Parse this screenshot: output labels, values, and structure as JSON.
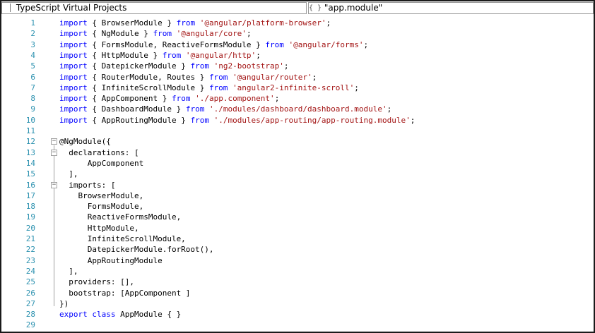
{
  "toolbar": {
    "project_dropdown": "TypeScript Virtual Projects",
    "member_dropdown": "\"app.module\"",
    "member_icon": "{ }"
  },
  "icons": {
    "project": "project-icon",
    "member": "braces-icon",
    "fold": "collapse-minus-icon"
  },
  "colors": {
    "keyword": "#0000ff",
    "string": "#a31515",
    "line_number": "#2b91af",
    "text": "#000000"
  },
  "lines": [
    {
      "n": "1",
      "t": [
        {
          "k": "kw",
          "v": "import"
        },
        {
          "k": "p",
          "v": " { BrowserModule } "
        },
        {
          "k": "kw",
          "v": "from"
        },
        {
          "k": "p",
          "v": " "
        },
        {
          "k": "str",
          "v": "'@angular/platform-browser'"
        },
        {
          "k": "p",
          "v": ";"
        }
      ]
    },
    {
      "n": "2",
      "t": [
        {
          "k": "kw",
          "v": "import"
        },
        {
          "k": "p",
          "v": " { NgModule } "
        },
        {
          "k": "kw",
          "v": "from"
        },
        {
          "k": "p",
          "v": " "
        },
        {
          "k": "str",
          "v": "'@angular/core'"
        },
        {
          "k": "p",
          "v": ";"
        }
      ]
    },
    {
      "n": "3",
      "t": [
        {
          "k": "kw",
          "v": "import"
        },
        {
          "k": "p",
          "v": " { FormsModule, ReactiveFormsModule } "
        },
        {
          "k": "kw",
          "v": "from"
        },
        {
          "k": "p",
          "v": " "
        },
        {
          "k": "str",
          "v": "'@angular/forms'"
        },
        {
          "k": "p",
          "v": ";"
        }
      ]
    },
    {
      "n": "4",
      "t": [
        {
          "k": "kw",
          "v": "import"
        },
        {
          "k": "p",
          "v": " { HttpModule } "
        },
        {
          "k": "kw",
          "v": "from"
        },
        {
          "k": "p",
          "v": " "
        },
        {
          "k": "str",
          "v": "'@angular/http'"
        },
        {
          "k": "p",
          "v": ";"
        }
      ]
    },
    {
      "n": "5",
      "t": [
        {
          "k": "kw",
          "v": "import"
        },
        {
          "k": "p",
          "v": " { DatepickerModule } "
        },
        {
          "k": "kw",
          "v": "from"
        },
        {
          "k": "p",
          "v": " "
        },
        {
          "k": "str",
          "v": "'ng2-bootstrap'"
        },
        {
          "k": "p",
          "v": ";"
        }
      ]
    },
    {
      "n": "6",
      "t": [
        {
          "k": "kw",
          "v": "import"
        },
        {
          "k": "p",
          "v": " { RouterModule, Routes } "
        },
        {
          "k": "kw",
          "v": "from"
        },
        {
          "k": "p",
          "v": " "
        },
        {
          "k": "str",
          "v": "'@angular/router'"
        },
        {
          "k": "p",
          "v": ";"
        }
      ]
    },
    {
      "n": "7",
      "t": [
        {
          "k": "kw",
          "v": "import"
        },
        {
          "k": "p",
          "v": " { InfiniteScrollModule } "
        },
        {
          "k": "kw",
          "v": "from"
        },
        {
          "k": "p",
          "v": " "
        },
        {
          "k": "str",
          "v": "'angular2-infinite-scroll'"
        },
        {
          "k": "p",
          "v": ";"
        }
      ]
    },
    {
      "n": "8",
      "t": [
        {
          "k": "kw",
          "v": "import"
        },
        {
          "k": "p",
          "v": " { AppComponent } "
        },
        {
          "k": "kw",
          "v": "from"
        },
        {
          "k": "p",
          "v": " "
        },
        {
          "k": "str",
          "v": "'./app.component'"
        },
        {
          "k": "p",
          "v": ";"
        }
      ]
    },
    {
      "n": "9",
      "t": [
        {
          "k": "kw",
          "v": "import"
        },
        {
          "k": "p",
          "v": " { DashboardModule } "
        },
        {
          "k": "kw",
          "v": "from"
        },
        {
          "k": "p",
          "v": " "
        },
        {
          "k": "str",
          "v": "'./modules/dashboard/dashboard.module'"
        },
        {
          "k": "p",
          "v": ";"
        }
      ]
    },
    {
      "n": "10",
      "t": [
        {
          "k": "kw",
          "v": "import"
        },
        {
          "k": "p",
          "v": " { AppRoutingModule } "
        },
        {
          "k": "kw",
          "v": "from"
        },
        {
          "k": "p",
          "v": " "
        },
        {
          "k": "str",
          "v": "'./modules/app-routing/app-routing.module'"
        },
        {
          "k": "p",
          "v": ";"
        }
      ]
    },
    {
      "n": "11",
      "t": []
    },
    {
      "n": "12",
      "t": [
        {
          "k": "p",
          "v": "@NgModule({"
        }
      ]
    },
    {
      "n": "13",
      "t": [
        {
          "k": "p",
          "v": "  declarations: ["
        }
      ]
    },
    {
      "n": "14",
      "t": [
        {
          "k": "p",
          "v": "      AppComponent"
        }
      ]
    },
    {
      "n": "15",
      "t": [
        {
          "k": "p",
          "v": "  ],"
        }
      ]
    },
    {
      "n": "16",
      "t": [
        {
          "k": "p",
          "v": "  imports: ["
        }
      ]
    },
    {
      "n": "17",
      "t": [
        {
          "k": "p",
          "v": "    BrowserModule,"
        }
      ]
    },
    {
      "n": "18",
      "t": [
        {
          "k": "p",
          "v": "      FormsModule,"
        }
      ]
    },
    {
      "n": "19",
      "t": [
        {
          "k": "p",
          "v": "      ReactiveFormsModule,"
        }
      ]
    },
    {
      "n": "20",
      "t": [
        {
          "k": "p",
          "v": "      HttpModule,"
        }
      ]
    },
    {
      "n": "21",
      "t": [
        {
          "k": "p",
          "v": "      InfiniteScrollModule,"
        }
      ]
    },
    {
      "n": "22",
      "t": [
        {
          "k": "p",
          "v": "      DatepickerModule.forRoot(),"
        }
      ]
    },
    {
      "n": "23",
      "t": [
        {
          "k": "p",
          "v": "      AppRoutingModule"
        }
      ]
    },
    {
      "n": "24",
      "t": [
        {
          "k": "p",
          "v": "  ],"
        }
      ]
    },
    {
      "n": "25",
      "t": [
        {
          "k": "p",
          "v": "  providers: [],"
        }
      ]
    },
    {
      "n": "26",
      "t": [
        {
          "k": "p",
          "v": "  bootstrap: [AppComponent ]"
        }
      ]
    },
    {
      "n": "27",
      "t": [
        {
          "k": "p",
          "v": "})"
        }
      ]
    },
    {
      "n": "28",
      "t": [
        {
          "k": "kw",
          "v": "export"
        },
        {
          "k": "p",
          "v": " "
        },
        {
          "k": "kw",
          "v": "class"
        },
        {
          "k": "p",
          "v": " AppModule { }"
        }
      ]
    },
    {
      "n": "29",
      "t": []
    }
  ]
}
